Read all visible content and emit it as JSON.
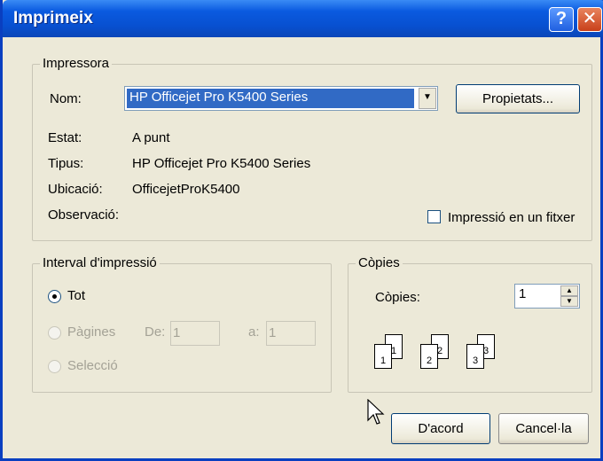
{
  "window": {
    "title": "Imprimeix"
  },
  "printer": {
    "legend": "Impressora",
    "name_label": "Nom:",
    "name_value": "HP Officejet Pro K5400 Series",
    "properties_button": "Propietats...",
    "status_label": "Estat:",
    "status_value": "A punt",
    "type_label": "Tipus:",
    "type_value": "HP Officejet Pro K5400 Series",
    "location_label": "Ubicació:",
    "location_value": "OfficejetProK5400",
    "comment_label": "Observació:",
    "print_to_file_label": "Impressió en un fitxer"
  },
  "range": {
    "legend": "Interval d'impressió",
    "all_label": "Tot",
    "pages_label": "Pàgines",
    "from_label": "De:",
    "from_value": "1",
    "to_label": "a:",
    "to_value": "1",
    "selection_label": "Selecció"
  },
  "copies": {
    "legend": "Còpies",
    "count_label": "Còpies:",
    "count_value": "1",
    "collate_pages": [
      "1",
      "1",
      "2",
      "2",
      "3",
      "3"
    ]
  },
  "actions": {
    "ok_label": "D'acord",
    "cancel_label": "Cancel·la"
  },
  "icons": {
    "help": "help-icon",
    "close": "close-icon",
    "dropdown": "chevron-down-icon",
    "cursor": "mouse-cursor-icon"
  }
}
